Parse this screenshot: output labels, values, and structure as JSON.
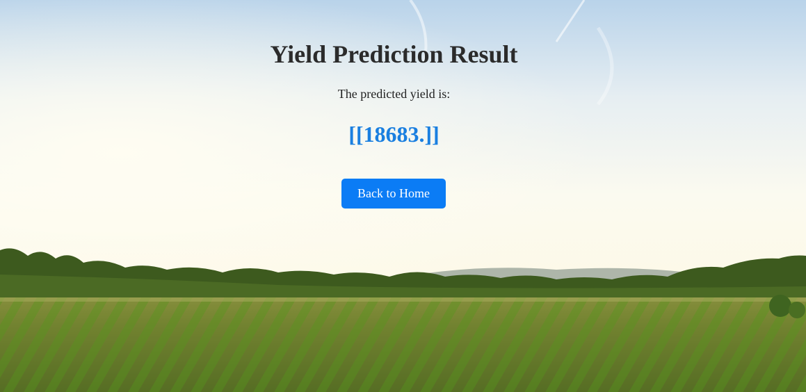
{
  "page": {
    "title": "Yield Prediction Result",
    "subtitle": "The predicted yield is:",
    "result": "[[18683.]]",
    "back_button_label": "Back to Home"
  },
  "colors": {
    "accent": "#0b7cf5",
    "result_text": "#1a7fe0",
    "title_text": "#2b2b2b"
  },
  "background": {
    "scene": "crop-field-landscape"
  }
}
